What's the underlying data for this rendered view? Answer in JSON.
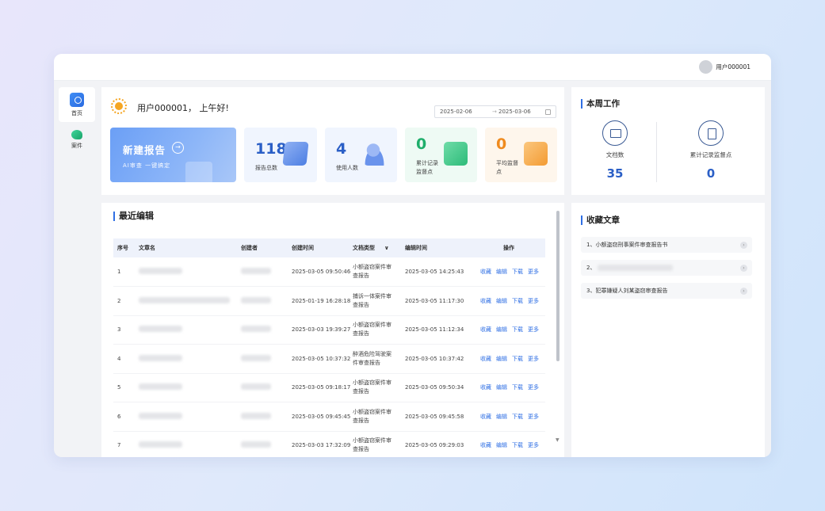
{
  "header": {
    "user_name": "用户000001"
  },
  "sidebar": {
    "items": [
      {
        "label": "首页",
        "icon": "home-icon"
      },
      {
        "label": "案件",
        "icon": "case-icon"
      }
    ]
  },
  "welcome": {
    "greeting": "用户000001， 上午好!",
    "date_start": "2025-02-06",
    "date_sep": "→",
    "date_end": "2025-03-06",
    "new_report": {
      "title": "新建报告",
      "subtitle": "AI审查 一键搞定"
    },
    "stats": [
      {
        "value": "118",
        "label": "报告总数"
      },
      {
        "value": "4",
        "label": "使用人数"
      },
      {
        "value": "0",
        "label_1": "累计记录",
        "label_2": "监督点"
      },
      {
        "value": "0",
        "label_1": "平均监督",
        "label_2": "点"
      }
    ]
  },
  "weekly": {
    "title": "本周工作",
    "items": [
      {
        "label": "文档数",
        "value": "35"
      },
      {
        "label": "累计记录监督点",
        "value": "0"
      }
    ]
  },
  "recent": {
    "title": "最近编辑",
    "columns": [
      "序号",
      "文章名",
      "创建者",
      "创建时间",
      "文档类型",
      "编辑时间",
      "操作"
    ],
    "rows": [
      {
        "idx": "1",
        "created": "2025-03-05 09:50:46",
        "type_1": "小额盗窃案件审",
        "type_2": "查报告",
        "edited": "2025-03-05 14:25:43"
      },
      {
        "idx": "2",
        "created": "2025-01-19 16:28:18",
        "type_1": "捕诉一体案件审",
        "type_2": "查报告",
        "edited": "2025-03-05 11:17:30"
      },
      {
        "idx": "3",
        "created": "2025-03-03 19:39:27",
        "type_1": "小额盗窃案件审",
        "type_2": "查报告",
        "edited": "2025-03-05 11:12:34"
      },
      {
        "idx": "4",
        "created": "2025-03-05 10:37:32",
        "type_1": "醉酒危险驾驶案",
        "type_2": "件审查报告",
        "edited": "2025-03-05 10:37:42"
      },
      {
        "idx": "5",
        "created": "2025-03-05 09:18:17",
        "type_1": "小额盗窃案件审",
        "type_2": "查报告",
        "edited": "2025-03-05 09:50:34"
      },
      {
        "idx": "6",
        "created": "2025-03-05 09:45:45",
        "type_1": "小额盗窃案件审",
        "type_2": "查报告",
        "edited": "2025-03-05 09:45:58"
      },
      {
        "idx": "7",
        "created": "2025-03-03 17:32:09",
        "type_1": "小额盗窃案件审",
        "type_2": "查报告",
        "edited": "2025-03-05 09:29:03"
      }
    ],
    "ops": {
      "collect": "收藏",
      "edit": "编辑",
      "download": "下载",
      "more": "更多"
    }
  },
  "favorites": {
    "title": "收藏文章",
    "items": [
      "1、小额盗窃刑事案件审查报告书",
      "2、",
      "3、犯罪嫌疑人刘某盗窃审查报告"
    ]
  },
  "colors": {
    "accent": "#2f6fe4",
    "blue_stat": "#2b5fc6",
    "green_stat": "#1fae6b",
    "orange_stat": "#ef8b1f"
  }
}
